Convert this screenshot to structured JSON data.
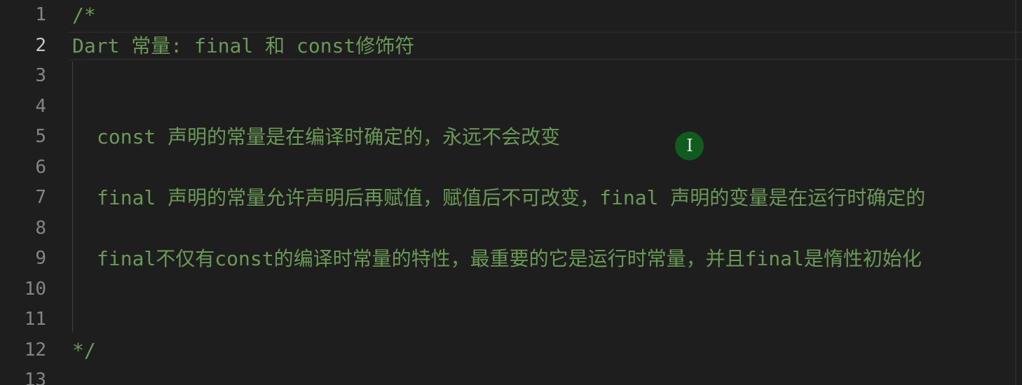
{
  "editor": {
    "language": "Dart",
    "active_line": 2,
    "comment_color": "#6a9955",
    "line_number_color": "#858585",
    "lines": [
      {
        "number": "1",
        "text": "/*"
      },
      {
        "number": "2",
        "text": "Dart 常量: final 和 const修饰符"
      },
      {
        "number": "3",
        "text": ""
      },
      {
        "number": "4",
        "text": ""
      },
      {
        "number": "5",
        "text": "const 声明的常量是在编译时确定的，永远不会改变"
      },
      {
        "number": "6",
        "text": ""
      },
      {
        "number": "7",
        "text": "final 声明的常量允许声明后再赋值，赋值后不可改变，final 声明的变量是在运行时确定的"
      },
      {
        "number": "8",
        "text": ""
      },
      {
        "number": "9",
        "text": "final不仅有const的编译时常量的特性，最重要的它是运行时常量，并且final是惰性初始化"
      },
      {
        "number": "10",
        "text": ""
      },
      {
        "number": "11",
        "text": ""
      },
      {
        "number": "12",
        "text": "*/"
      },
      {
        "number": "13",
        "text": ""
      }
    ]
  },
  "mouse_cursor": {
    "icon": "text-cursor-icon",
    "glyph": "I"
  }
}
